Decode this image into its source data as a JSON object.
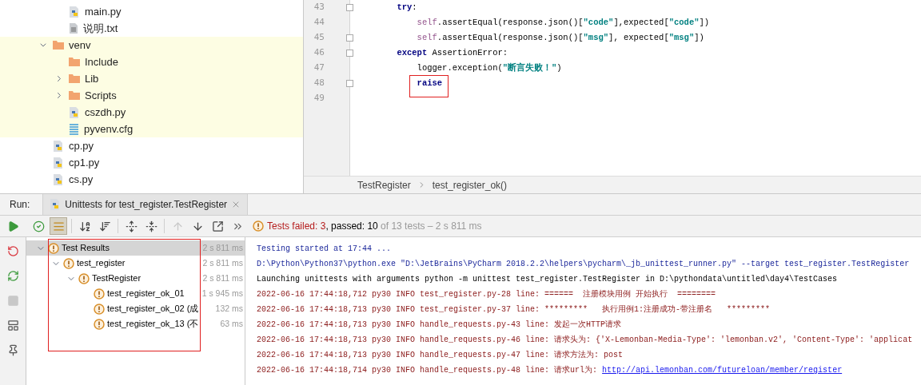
{
  "project_tree": {
    "items_above": [
      {
        "name": "main.py",
        "kind": "python"
      },
      {
        "name": "说明.txt",
        "kind": "text"
      }
    ],
    "items": [
      {
        "name": "venv",
        "kind": "folder",
        "expanded": true,
        "excluded": true,
        "children": [
          {
            "name": "Include",
            "kind": "folder"
          },
          {
            "name": "Lib",
            "kind": "folder",
            "expanded": false
          },
          {
            "name": "Scripts",
            "kind": "folder",
            "expanded": false
          },
          {
            "name": "cszdh.py",
            "kind": "python"
          },
          {
            "name": "pyvenv.cfg",
            "kind": "config"
          }
        ]
      },
      {
        "name": "cp.py",
        "kind": "python"
      },
      {
        "name": "cp1.py",
        "kind": "python"
      },
      {
        "name": "cs.py",
        "kind": "python"
      }
    ]
  },
  "editor": {
    "lines": [
      {
        "number": "43",
        "fold": true,
        "tokens": [
          {
            "kind": "keyword",
            "text": "        try"
          },
          {
            "kind": "plain",
            "text": ":"
          }
        ]
      },
      {
        "number": "44",
        "fold": false,
        "tokens": [
          {
            "kind": "self",
            "text": "            self"
          },
          {
            "kind": "plain",
            "text": ".assertEqual(response.json()["
          },
          {
            "kind": "string",
            "text": "\"code\""
          },
          {
            "kind": "plain",
            "text": "],expected["
          },
          {
            "kind": "string",
            "text": "\"code\""
          },
          {
            "kind": "plain",
            "text": "])"
          }
        ]
      },
      {
        "number": "45",
        "fold": true,
        "tokens": [
          {
            "kind": "self",
            "text": "            self"
          },
          {
            "kind": "plain",
            "text": ".assertEqual(response.json()["
          },
          {
            "kind": "string",
            "text": "\"msg\""
          },
          {
            "kind": "plain",
            "text": "], expected["
          },
          {
            "kind": "string",
            "text": "\"msg\""
          },
          {
            "kind": "plain",
            "text": "])"
          }
        ]
      },
      {
        "number": "46",
        "fold": true,
        "tokens": [
          {
            "kind": "keyword",
            "text": "        except"
          },
          {
            "kind": "plain",
            "text": " AssertionError:"
          }
        ]
      },
      {
        "number": "47",
        "fold": false,
        "tokens": [
          {
            "kind": "plain",
            "text": "            logger.exception("
          },
          {
            "kind": "string",
            "text": "\"断言失败！\""
          },
          {
            "kind": "plain",
            "text": ")"
          }
        ]
      },
      {
        "number": "48",
        "fold": true,
        "boxed": true,
        "tokens": [
          {
            "kind": "keyword",
            "text": "            raise"
          }
        ]
      },
      {
        "number": "49",
        "fold": false
      }
    ],
    "breadcrumbs": [
      "TestRegister",
      "test_register_ok()"
    ]
  },
  "run": {
    "label": "Run:",
    "tab": "Unittests for test_register.TestRegister",
    "toolbar": [
      {
        "kind": "show-passed",
        "on": false,
        "disabled": false
      },
      {
        "kind": "show-ignored",
        "on": true,
        "disabled": false
      },
      {
        "kind": "sort-alpha",
        "on": false,
        "disabled": false
      },
      {
        "kind": "sort-duration",
        "on": false,
        "disabled": false
      },
      {
        "kind": "expand-all",
        "on": false,
        "disabled": false
      },
      {
        "kind": "collapse-all",
        "on": false,
        "disabled": false
      },
      {
        "kind": "previous",
        "on": false,
        "disabled": true
      },
      {
        "kind": "next",
        "on": false,
        "disabled": false
      },
      {
        "kind": "export",
        "on": false,
        "disabled": false
      },
      {
        "kind": "more",
        "on": false,
        "disabled": false
      }
    ],
    "side_tools": [
      {
        "kind": "rerun",
        "disabled": false
      },
      {
        "kind": "rerun-failed",
        "disabled": false
      },
      {
        "kind": "auto-test",
        "disabled": false
      },
      {
        "kind": "stop",
        "disabled": true
      },
      {
        "kind": "layout",
        "disabled": false
      },
      {
        "kind": "pin",
        "disabled": false
      }
    ],
    "summary": {
      "failed": "Tests failed: 3",
      "passed": ", passed: 10",
      "rest": " of 13 tests – 2 s 811 ms"
    },
    "results_boxed": true,
    "results": [
      {
        "name": "Test Results",
        "time": "2 s 811 ms",
        "selected": true,
        "expanded": true,
        "children": [
          {
            "name": "test_register",
            "time": "2 s 811 ms",
            "selected": false,
            "expanded": true,
            "children": [
              {
                "name": "TestRegister",
                "time": "2 s 811 ms",
                "selected": false,
                "expanded": true,
                "children": [
                  {
                    "name": "test_register_ok_01",
                    "time": "1 s 945 ms",
                    "selected": false
                  },
                  {
                    "name": "test_register_ok_02 (成",
                    "time": "132 ms",
                    "selected": false
                  },
                  {
                    "name": "test_register_ok_13 (不",
                    "time": "63 ms",
                    "selected": false
                  }
                ]
              }
            ]
          }
        ]
      }
    ],
    "console": [
      {
        "kind": "system",
        "text": "Testing started at 17:44 ..."
      },
      {
        "kind": "system",
        "text": "D:\\Python\\Python37\\python.exe \"D:\\JetBrains\\PyCharm 2018.2.2\\helpers\\pycharm\\_jb_unittest_runner.py\" --target test_register.TestRegister"
      },
      {
        "kind": "output",
        "text": "Launching unittests with arguments python -m unittest test_register.TestRegister in D:\\pythondata\\untitled\\day4\\TestCases"
      },
      {
        "kind": "log",
        "text": "2022-06-16 17:44:18,712 py30 INFO test_register.py-28 line: ======  注册模块用例 开始执行  ========"
      },
      {
        "kind": "log",
        "text": "2022-06-16 17:44:18,713 py30 INFO test_register.py-37 line: *********   执行用例1:注册成功-带注册名   *********"
      },
      {
        "kind": "log",
        "text": "2022-06-16 17:44:18,713 py30 INFO handle_requests.py-43 line: 发起一次HTTP请求"
      },
      {
        "kind": "log",
        "text": "2022-06-16 17:44:18,713 py30 INFO handle_requests.py-46 line: 请求头为: {'X-Lemonban-Media-Type': 'lemonban.v2', 'Content-Type': 'applicat"
      },
      {
        "kind": "log",
        "text": "2022-06-16 17:44:18,713 py30 INFO handle_requests.py-47 line: 请求方法为: post"
      },
      {
        "kind": "log",
        "text": "2022-06-16 17:44:18,714 py30 INFO handle_requests.py-48 line: 请求url为: ",
        "link": "http://api.lemonban.com/futureloan/member/register"
      }
    ]
  }
}
